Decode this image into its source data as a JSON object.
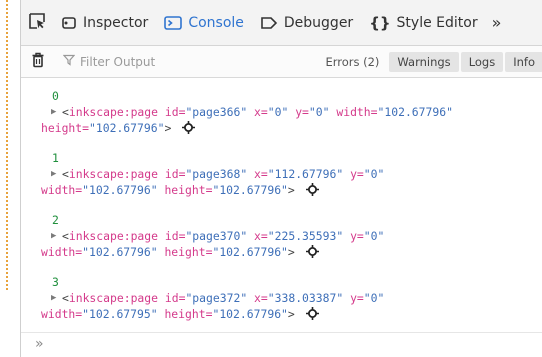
{
  "toolbar": {
    "tabs": [
      {
        "label": "Inspector",
        "icon": "inspector-icon",
        "selected": false
      },
      {
        "label": "Console",
        "icon": "console-icon",
        "selected": true
      },
      {
        "label": "Debugger",
        "icon": "debugger-icon",
        "selected": false
      },
      {
        "label": "Style Editor",
        "icon": "style-editor-icon",
        "selected": false
      }
    ],
    "more_label": "»"
  },
  "filterbar": {
    "placeholder": "Filter Output",
    "levels": [
      {
        "label": "Errors (2)",
        "active": false
      },
      {
        "label": "Warnings",
        "active": true
      },
      {
        "label": "Logs",
        "active": true
      },
      {
        "label": "Info",
        "active": true
      }
    ]
  },
  "log": {
    "entries": [
      {
        "index": "0",
        "tag": "inkscape:page",
        "id_attr": "id=",
        "id_val": "\"page366\"",
        "x_attr": "x=",
        "x_val": "\"0\"",
        "y_attr": "y=",
        "y_val": "\"0\"",
        "w_attr": "width=",
        "w_val": "\"102.67796\"",
        "h_attr": "height=",
        "h_val": "\"102.67796\""
      },
      {
        "index": "1",
        "tag": "inkscape:page",
        "id_attr": "id=",
        "id_val": "\"page368\"",
        "x_attr": "x=",
        "x_val": "\"112.67796\"",
        "y_attr": "y=",
        "y_val": "\"0\"",
        "w_attr": "width=",
        "w_val": "\"102.67796\"",
        "h_attr": "height=",
        "h_val": "\"102.67796\""
      },
      {
        "index": "2",
        "tag": "inkscape:page",
        "id_attr": "id=",
        "id_val": "\"page370\"",
        "x_attr": "x=",
        "x_val": "\"225.35593\"",
        "y_attr": "y=",
        "y_val": "\"0\"",
        "w_attr": "width=",
        "w_val": "\"102.67796\"",
        "h_attr": "height=",
        "h_val": "\"102.67796\""
      },
      {
        "index": "3",
        "tag": "inkscape:page",
        "id_attr": "id=",
        "id_val": "\"page372\"",
        "x_attr": "x=",
        "x_val": "\"338.03387\"",
        "y_attr": "y=",
        "y_val": "\"0\"",
        "w_attr": "width=",
        "w_val": "\"102.67795\"",
        "h_attr": "height=",
        "h_val": "\"102.67796\""
      }
    ]
  },
  "prompt": {
    "symbol": "»"
  },
  "colors": {
    "accent": "#2f74d0",
    "tag": "#d43a8b",
    "value": "#3e6fb8",
    "index": "#1f8f3c"
  }
}
